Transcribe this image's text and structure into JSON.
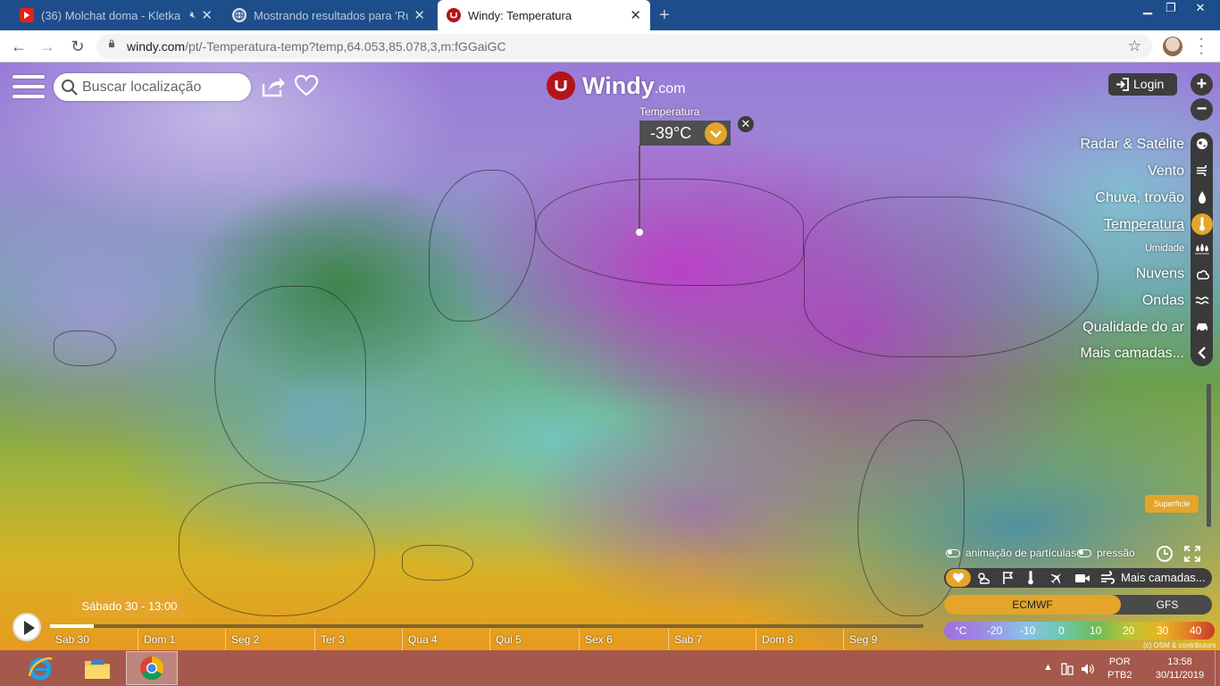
{
  "browser": {
    "tabs": [
      {
        "title": "(36) Molchat doma - Kletka",
        "icon": "youtube-icon",
        "muted": true
      },
      {
        "title": "Mostrando resultados para 'Rússia'",
        "icon": "globe-icon"
      },
      {
        "title": "Windy: Temperatura",
        "icon": "windy-icon",
        "active": true
      }
    ],
    "url_host": "windy.com",
    "url_path": "/pt/-Temperatura-temp?temp,64.053,85.078,3,m:fGGaiGC"
  },
  "search": {
    "placeholder": "Buscar localização"
  },
  "logo": {
    "name": "Windy",
    "suffix": ".com"
  },
  "picker": {
    "label": "Temperatura",
    "value": "-39°C"
  },
  "login_label": "Login",
  "zoom": {
    "in": "+",
    "out": "−"
  },
  "layers": [
    {
      "label": "Radar & Satélite",
      "icon": "globe-icon"
    },
    {
      "label": "Vento",
      "icon": "wind-icon"
    },
    {
      "label": "Chuva, trovão",
      "icon": "drop-icon"
    },
    {
      "label": "Temperatura",
      "icon": "thermometer-icon",
      "active": true
    },
    {
      "label": "Umidade",
      "icon": "humidity-icon",
      "small": true
    },
    {
      "label": "Nuvens",
      "icon": "cloud-icon"
    },
    {
      "label": "Ondas",
      "icon": "waves-icon"
    },
    {
      "label": "Qualidade do ar",
      "icon": "car-icon"
    },
    {
      "label": "Mais camadas...",
      "icon": "chevron-left-icon"
    }
  ],
  "superficie_label": "Superfície",
  "toggles": {
    "particles": "animação de partículas",
    "pressure": "pressão"
  },
  "overlay_more": "Mais camadas...",
  "models": {
    "ecmwf": "ECMWF",
    "gfs": "GFS"
  },
  "legend": {
    "unit": "°C",
    "ticks": [
      "-20",
      "-10",
      "0",
      "10",
      "20",
      "30",
      "40"
    ]
  },
  "attribution": "(c) OSM & contributors",
  "timeline": {
    "current": "Sábado 30 - 13:00",
    "progress": 0.05,
    "days": [
      "Sab 30",
      "Dom 1",
      "Seg 2",
      "Ter 3",
      "Qua 4",
      "Qui 5",
      "Sex 6",
      "Sab 7",
      "Dom 8",
      "Seg 9"
    ]
  },
  "taskbar": {
    "apps": [
      "internet-explorer-icon",
      "file-explorer-icon",
      "chrome-icon"
    ],
    "lang": [
      "POR",
      "PTB2"
    ],
    "time": "13:58",
    "date": "30/11/2019"
  },
  "colors": {
    "accent": "#e3a52a",
    "brand": "#b3141b",
    "dark": "#3d3d3d"
  }
}
